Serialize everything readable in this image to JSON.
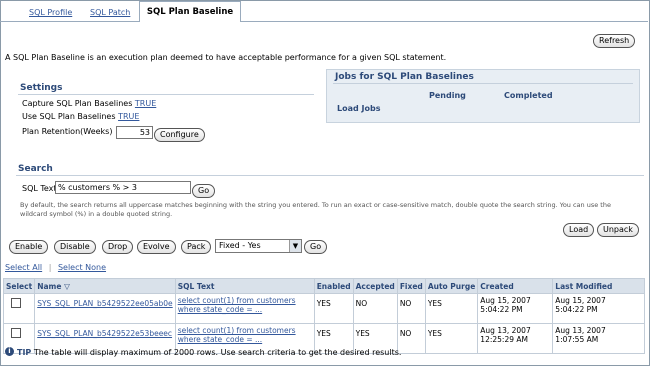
{
  "tabs": [
    "SQL Profile",
    "SQL Patch",
    "SQL Plan Baseline"
  ],
  "description": "A SQL Plan Baseline is an execution plan deemed to have acceptable performance for a given SQL statement.",
  "refresh_label": "Refresh",
  "settings": {
    "header": "Settings",
    "capture_label": "Capture SQL Plan Baselines",
    "capture_value": "TRUE",
    "use_label": "Use SQL Plan Baselines",
    "use_value": "TRUE",
    "retention_label": "Plan Retention(Weeks)",
    "retention_value": "53",
    "configure_label": "Configure"
  },
  "jobs": {
    "header": "Jobs for SQL Plan Baselines",
    "col_pending": "Pending",
    "col_completed": "Completed",
    "row_label": "Load Jobs"
  },
  "search": {
    "header": "Search",
    "sql_text_label": "SQL Text",
    "sql_text_value": "% customers % > 3",
    "go_label": "Go",
    "help": "By default, the search returns all uppercase matches beginning with the string you entered. To run an exact or case-sensitive match, double quote the search string. You can use the wildcard symbol (%) in a double quoted string."
  },
  "actions": {
    "load": "Load",
    "unpack": "Unpack",
    "enable": "Enable",
    "disable": "Disable",
    "drop": "Drop",
    "evolve": "Evolve",
    "pack": "Pack",
    "fixed_select": "Fixed - Yes",
    "go": "Go",
    "select_all": "Select All",
    "select_none": "Select None"
  },
  "table": {
    "headers": [
      "Select",
      "Name",
      "SQL Text",
      "Enabled",
      "Accepted",
      "Fixed",
      "Auto Purge",
      "Created",
      "Last Modified"
    ],
    "sort_indicator": "▽",
    "rows": [
      {
        "name": "SYS_SQL_PLAN_b5429522ee05ab0e",
        "sql_text_1": "select count(1) from customers",
        "sql_text_2": "where state_code = ...",
        "enabled": "YES",
        "accepted": "NO",
        "fixed": "NO",
        "auto_purge": "YES",
        "created_1": "Aug 15, 2007",
        "created_2": "5:04:22 PM",
        "modified_1": "Aug 15, 2007",
        "modified_2": "5:04:22 PM"
      },
      {
        "name": "SYS_SQL_PLAN_b5429522e53beeec",
        "sql_text_1": "select count(1) from customers",
        "sql_text_2": "where state_code = ...",
        "enabled": "YES",
        "accepted": "YES",
        "fixed": "NO",
        "auto_purge": "YES",
        "created_1": "Aug 13, 2007",
        "created_2": "12:25:29 AM",
        "modified_1": "Aug 13, 2007",
        "modified_2": "1:07:55 AM"
      }
    ]
  },
  "tip": {
    "label": "TIP",
    "text": "The table will display maximum of 2000 rows. Use search criteria to get the desired results."
  }
}
